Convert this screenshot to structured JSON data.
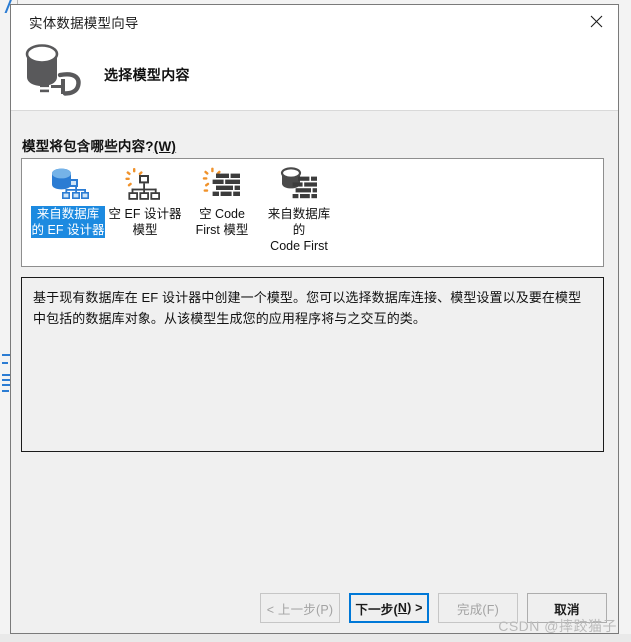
{
  "window": {
    "title": "实体数据模型向导",
    "close_icon": "close-icon"
  },
  "header": {
    "icon": "database-plug-icon",
    "title": "选择模型内容"
  },
  "form": {
    "group_label_text": "模型将包含哪些内容?",
    "group_label_accesskey": "(W)"
  },
  "templates": [
    {
      "label": "来自数据库\n的 EF 设计器",
      "icon": "database-designer-icon",
      "selected": true
    },
    {
      "label": "空 EF 设计器\n模型",
      "icon": "empty-designer-icon",
      "selected": false
    },
    {
      "label": "空 Code\nFirst 模型",
      "icon": "empty-code-first-icon",
      "selected": false
    },
    {
      "label": "来自数据库的\nCode First",
      "icon": "database-code-first-icon",
      "selected": false
    }
  ],
  "description": {
    "text": "基于现有数据库在 EF 设计器中创建一个模型。您可以选择数据库连接、模型设置以及要在模型中包括的数据库对象。从该模型生成您的应用程序将与之交互的类。"
  },
  "buttons": {
    "back": {
      "label": "< 上一步(P)",
      "disabled": true
    },
    "next_prefix": "下一步(",
    "next_key": "N",
    "next_suffix": ") >",
    "finish": {
      "label": "完成(F)",
      "disabled": true
    },
    "cancel": {
      "label": "取消",
      "disabled": false
    }
  },
  "watermark": "CSDN @摔跤猫子",
  "colors": {
    "accent": "#0078d7",
    "selection": "#1c8ae0",
    "dialog_bg": "#f0f0f0",
    "icon_blue": "#2b7cd3",
    "icon_dark": "#4a4a4a",
    "icon_orange": "#f0922b"
  }
}
